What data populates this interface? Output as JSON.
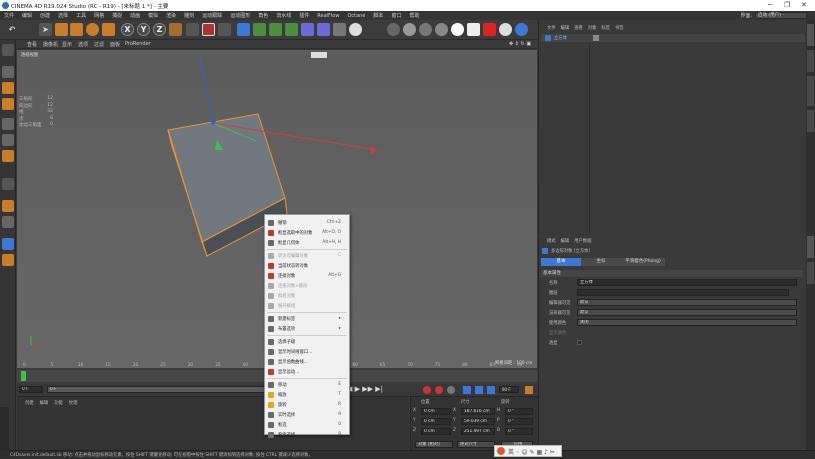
{
  "window": {
    "title": "CINEMA 4D R19.024 Studio (RC - R19) - [未标题 1 *] - 主要",
    "controls": [
      "─",
      "❐",
      "✕"
    ]
  },
  "menubar": {
    "items": [
      "文件",
      "编辑",
      "创建",
      "选择",
      "工具",
      "网格",
      "捕捉",
      "动画",
      "模拟",
      "渲染",
      "雕刻",
      "运动跟踪",
      "运动图形",
      "角色",
      "流水线",
      "插件",
      "RealFlow",
      "Octane",
      "脚本",
      "窗口",
      "帮助"
    ],
    "interface_label": "界面:",
    "interface_value": "启动 (用户)"
  },
  "toolbar": {
    "axis_x": "X",
    "axis_y": "Y",
    "axis_z": "Z"
  },
  "viewport_menu": [
    "查看",
    "摄像机",
    "显示",
    "选项",
    "过滤",
    "面板",
    "ProRender"
  ],
  "viewport": {
    "label": "透视视图",
    "hud_rows": [
      [
        "三角形",
        "12"
      ],
      [
        "四边形",
        "12"
      ],
      [
        "线",
        "32"
      ],
      [
        "点",
        "8"
      ],
      [
        "坎边三角面",
        "0"
      ]
    ],
    "grid_spacing": "网格间距 : 100 cm"
  },
  "context_menu": {
    "items": [
      {
        "label": "撤销",
        "shortcut": "Ctrl+Z",
        "disabled": false,
        "color": "#6a6a6a"
      },
      {
        "label": "框显选取中的对象",
        "shortcut": "Alt+O, O",
        "disabled": false,
        "color": "#c0392b"
      },
      {
        "label": "框显几何体",
        "shortcut": "Alt+H, H",
        "disabled": false,
        "color": "#6a6a6a"
      },
      {
        "sep": true
      },
      {
        "label": "转为可编辑对象",
        "shortcut": "C",
        "disabled": true,
        "color": "#aaaaaa"
      },
      {
        "label": "当前状态转对象",
        "shortcut": "",
        "disabled": false,
        "color": "#c0392b"
      },
      {
        "label": "连接对象",
        "shortcut": "Alt+G",
        "disabled": false,
        "color": "#c0392b"
      },
      {
        "label": "连接对象+删除",
        "shortcut": "",
        "disabled": true,
        "color": "#aaaaaa"
      },
      {
        "label": "群组对象",
        "shortcut": "",
        "disabled": true,
        "color": "#aaaaaa"
      },
      {
        "label": "展开群组",
        "shortcut": "",
        "disabled": true,
        "color": "#aaaaaa"
      },
      {
        "sep": true
      },
      {
        "label": "新建标签",
        "shortcut": "▸",
        "disabled": false,
        "color": "#6a6a6a"
      },
      {
        "label": "布置选项",
        "shortcut": "▸",
        "disabled": false,
        "color": "#6a6a6a"
      },
      {
        "sep": true
      },
      {
        "label": "选择子级",
        "shortcut": "",
        "disabled": false,
        "color": "#6a6a6a"
      },
      {
        "label": "显示时间线窗口...",
        "shortcut": "",
        "disabled": false,
        "color": "#6a6a6a"
      },
      {
        "label": "显示函数曲线...",
        "shortcut": "",
        "disabled": false,
        "color": "#6a6a6a"
      },
      {
        "label": "显示运动...",
        "shortcut": "",
        "disabled": false,
        "color": "#c0392b"
      },
      {
        "sep": true
      },
      {
        "label": "移动",
        "shortcut": "E",
        "disabled": false,
        "color": "#6a6a6a"
      },
      {
        "label": "缩放",
        "shortcut": "T",
        "disabled": false,
        "color": "#e6a817"
      },
      {
        "label": "旋转",
        "shortcut": "R",
        "disabled": false,
        "color": "#e6a817"
      },
      {
        "label": "实时选择",
        "shortcut": "9",
        "disabled": false,
        "color": "#6a6a6a"
      },
      {
        "label": "框选",
        "shortcut": "0",
        "disabled": false,
        "color": "#6a6a6a"
      },
      {
        "label": "套索选择",
        "shortcut": "8",
        "disabled": false,
        "color": "#6a6a6a"
      }
    ]
  },
  "timeline": {
    "ticks": [
      "0",
      "5",
      "10",
      "15",
      "20",
      "25",
      "30",
      "35",
      "40",
      "45",
      "50",
      "55",
      "60",
      "65",
      "70",
      "75",
      "80",
      "85",
      "90"
    ],
    "start_frame": "0 F",
    "current_frame": "0 F",
    "end_frame": "90 F"
  },
  "material_panel": {
    "tabs": [
      "创建",
      "编辑",
      "功能",
      "纹理"
    ]
  },
  "coordinates": {
    "headers": [
      "位置",
      "尺寸",
      "旋转"
    ],
    "rows": [
      {
        "axis": "X",
        "pos": "0 cm",
        "size_axis": "X",
        "size": "187.616 cm",
        "rot_axis": "H",
        "rot": "0 °"
      },
      {
        "axis": "Y",
        "pos": "0 cm",
        "size_axis": "Y",
        "size": "59.039 cm",
        "rot_axis": "P",
        "rot": "0 °"
      },
      {
        "axis": "Z",
        "pos": "0 cm",
        "size_axis": "Z",
        "size": "251.497 cm",
        "rot_axis": "B",
        "rot": "0 °"
      }
    ],
    "mode_left": "对象 (相对)",
    "mode_right": "绝对尺寸",
    "apply": "应用"
  },
  "object_manager": {
    "menu": [
      "文件",
      "编辑",
      "查看",
      "对象",
      "标签",
      "书签"
    ],
    "object_name": "立方体"
  },
  "attributes": {
    "menu": [
      "模式",
      "编辑",
      "用户数据"
    ],
    "title": "多边形对象 [立方体]",
    "tabs": [
      "基本",
      "坐标",
      "平滑着色(Phong)"
    ],
    "section": "基本属性",
    "rows": [
      {
        "label": "名称",
        "value": "立方体"
      },
      {
        "label": "图层",
        "value": ""
      },
      {
        "label": "编辑器可见",
        "value": "默认"
      },
      {
        "label": "渲染器可见",
        "value": "默认"
      },
      {
        "label": "使用颜色",
        "value": "关闭"
      },
      {
        "label": "显示颜色",
        "value": ""
      },
      {
        "label": "透显",
        "value": ""
      }
    ]
  },
  "status": {
    "text": "C4Dsaver.init.default.lib    移动: 点击并拖动鼠标移动元素。按住 SHIFT 键量化移动; 可在视窗中按住 SHIFT 键添加到选择对象; 按住 CTRL 键减少选择对象。",
    "maxon": "MAXON CINEMA 4D"
  },
  "right_tabs": [
    "对象",
    "场次",
    "内容浏览器",
    "构造",
    "属性",
    "层"
  ],
  "colors": {
    "accent": "#3c78d8",
    "selection_orange": "#e8952e",
    "axis_x": "#d23c3c",
    "axis_y": "#3cc24a",
    "axis_z": "#3c5cd2"
  }
}
